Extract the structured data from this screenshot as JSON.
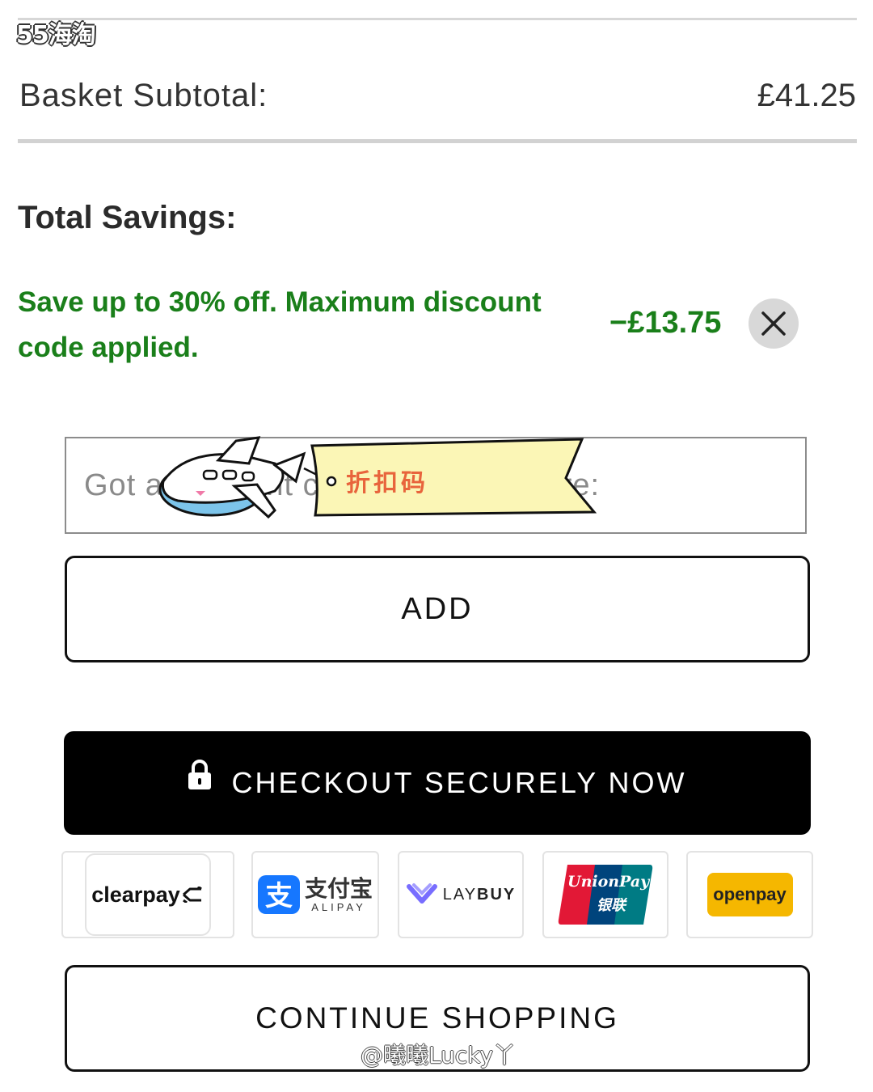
{
  "watermark_top": "55海淘",
  "summary": {
    "subtotal_label": "Basket Subtotal:",
    "subtotal_value": "£41.25",
    "savings_title": "Total Savings:",
    "discount_message": "Save up to 30% off. Maximum discount code applied.",
    "discount_amount": "−£13.75"
  },
  "promo": {
    "placeholder": "Got a discount code? Add it in here:",
    "sticker_label": "折扣码",
    "add_label": "ADD"
  },
  "checkout": {
    "label": "CHECKOUT SECURELY NOW"
  },
  "payment_methods": [
    {
      "name": "clearpay",
      "label": "clearpay"
    },
    {
      "name": "alipay",
      "label": "支付宝",
      "sub": "ALIPAY"
    },
    {
      "name": "laybuy",
      "label_light": "LAY",
      "label_bold": "BUY"
    },
    {
      "name": "unionpay",
      "label": "UnionPay",
      "sub": "银联"
    },
    {
      "name": "openpay",
      "label": "openpay"
    }
  ],
  "continue": {
    "label": "CONTINUE SHOPPING"
  },
  "watermark_bottom": "@曦曦Lucky丫",
  "colors": {
    "savings_green": "#1a7f1a",
    "checkout_bg": "#000000",
    "openpay_yellow": "#f5b700",
    "alipay_blue": "#1677ff"
  }
}
